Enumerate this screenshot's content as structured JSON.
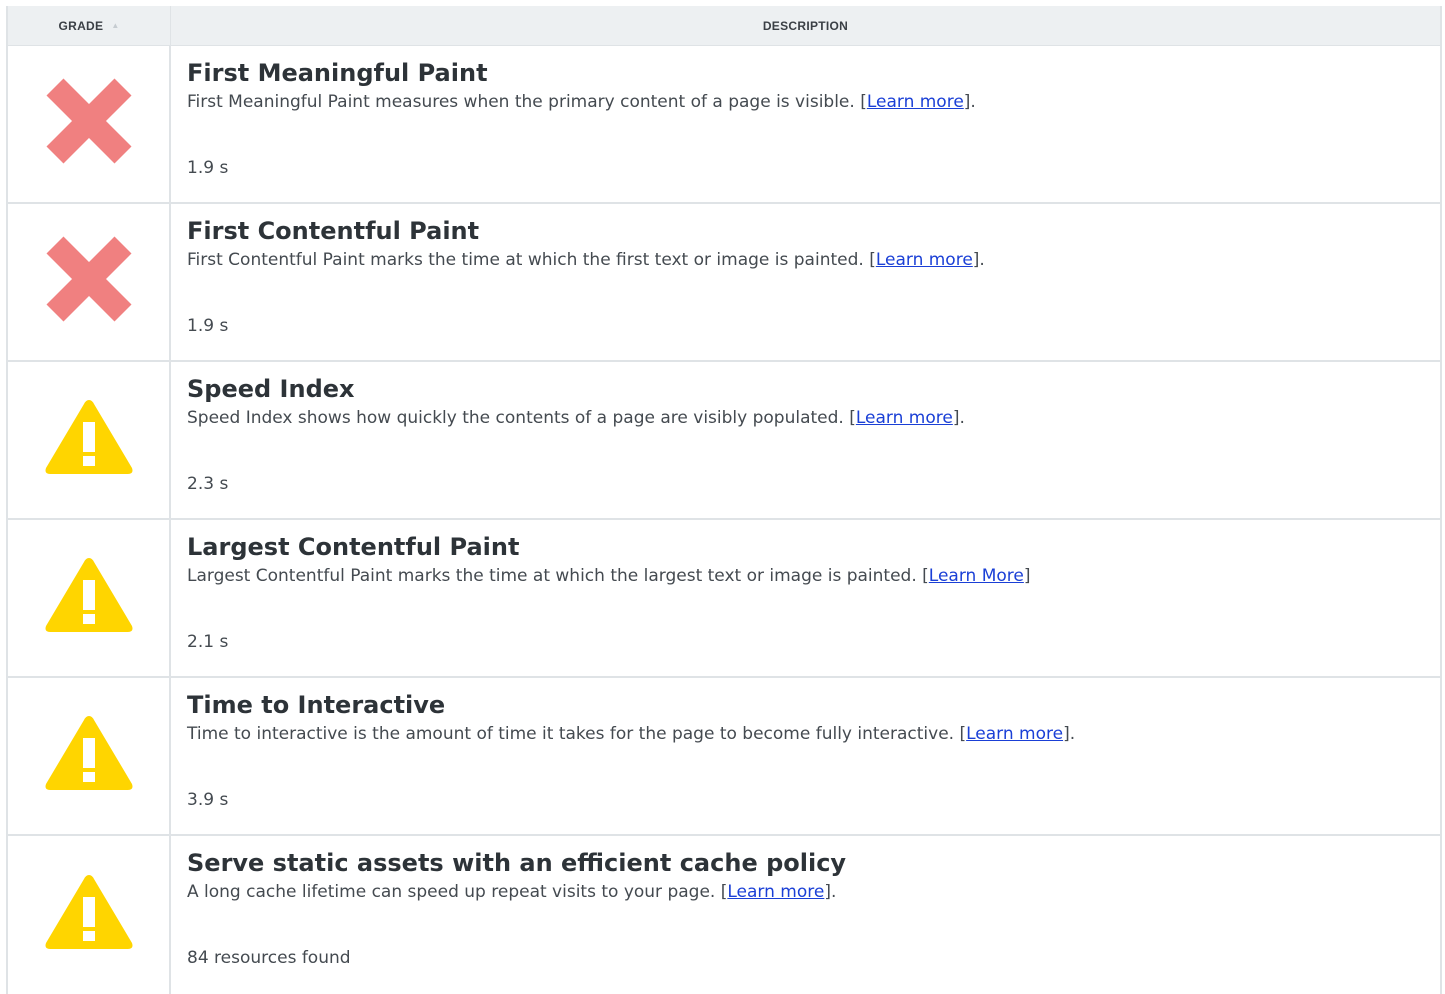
{
  "table": {
    "headers": {
      "grade": "GRADE",
      "description": "DESCRIPTION"
    },
    "sort_icon": "sort-ascending-icon",
    "colors": {
      "fail": "#f08080",
      "warn": "#ffd500",
      "link": "#1a3fd6"
    },
    "rows": [
      {
        "grade": "fail",
        "title": "First Meaningful Paint",
        "desc_before": "First Meaningful Paint measures when the primary content of a page is visible. [",
        "link": "Learn more",
        "desc_after": "].",
        "value": "1.9 s"
      },
      {
        "grade": "fail",
        "title": "First Contentful Paint",
        "desc_before": "First Contentful Paint marks the time at which the first text or image is painted. [",
        "link": "Learn more",
        "desc_after": "].",
        "value": "1.9 s"
      },
      {
        "grade": "warn",
        "title": "Speed Index",
        "desc_before": "Speed Index shows how quickly the contents of a page are visibly populated. [",
        "link": "Learn more",
        "desc_after": "].",
        "value": "2.3 s"
      },
      {
        "grade": "warn",
        "title": "Largest Contentful Paint",
        "desc_before": "Largest Contentful Paint marks the time at which the largest text or image is painted. [",
        "link": "Learn More",
        "desc_after": "]",
        "value": "2.1 s"
      },
      {
        "grade": "warn",
        "title": "Time to Interactive",
        "desc_before": "Time to interactive is the amount of time it takes for the page to become fully interactive. [",
        "link": "Learn more",
        "desc_after": "].",
        "value": "3.9 s"
      },
      {
        "grade": "warn",
        "title": "Serve static assets with an efficient cache policy",
        "desc_before": "A long cache lifetime can speed up repeat visits to your page. [",
        "link": "Learn more",
        "desc_after": "].",
        "value": "84 resources found"
      }
    ]
  }
}
